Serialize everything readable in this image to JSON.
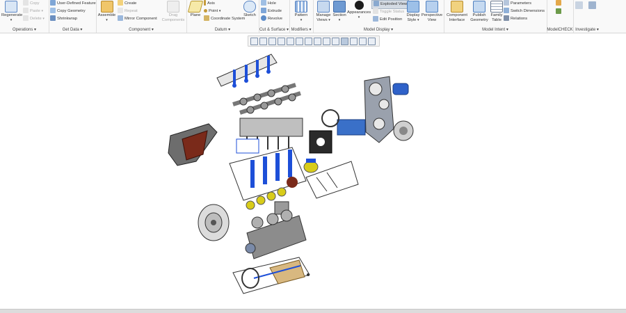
{
  "ribbon": {
    "operations": {
      "regenerate": "Regenerate",
      "copy": "Copy",
      "paste": "Paste",
      "delete": "Delete",
      "label": "Operations"
    },
    "get_data": {
      "udf": "User-Defined Feature",
      "copy_geometry": "Copy Geometry",
      "shrinkwrap": "Shrinkwrap",
      "label": "Get Data"
    },
    "component": {
      "assemble": "Assemble",
      "create": "Create",
      "repeat": "Repeat",
      "mirror": "Mirror Component",
      "drag": "Drag Components",
      "label": "Component"
    },
    "datum": {
      "plane": "Plane",
      "axis": "Axis",
      "point": "Point",
      "csys": "Coordinate System",
      "sketch": "Sketch",
      "label": "Datum"
    },
    "cut_surface": {
      "hole": "Hole",
      "extrude": "Extrude",
      "revolve": "Revolve",
      "label": "Cut & Surface"
    },
    "modifiers": {
      "pattern": "Pattern",
      "label": "Modifiers"
    },
    "model_display": {
      "manage_views": "Manage Views",
      "section": "Section",
      "appearances": "Appearances",
      "exploded_view": "Exploded View",
      "toggle_status": "Toggle Status",
      "edit_position": "Edit Position",
      "display_style": "Display Style",
      "perspective_view": "Perspective View",
      "label": "Model Display"
    },
    "model_intent": {
      "component_interface": "Component Interface",
      "publish_geometry": "Publish Geometry",
      "family_table": "Family Table",
      "parameters": "Parameters",
      "switch_dimensions": "Switch Dimensions",
      "relations": "Relations",
      "label": "Model Intent"
    },
    "modelcheck": {
      "label": "ModelCHECK"
    },
    "investigate": {
      "label": "Investigate"
    }
  },
  "colors": {
    "ribbon_bg": "#f9f9f9",
    "accent": "#2f6fb8",
    "model_blue": "#1d4fd8",
    "model_yellow": "#d8cc1a",
    "model_red": "#7a2a1a"
  }
}
